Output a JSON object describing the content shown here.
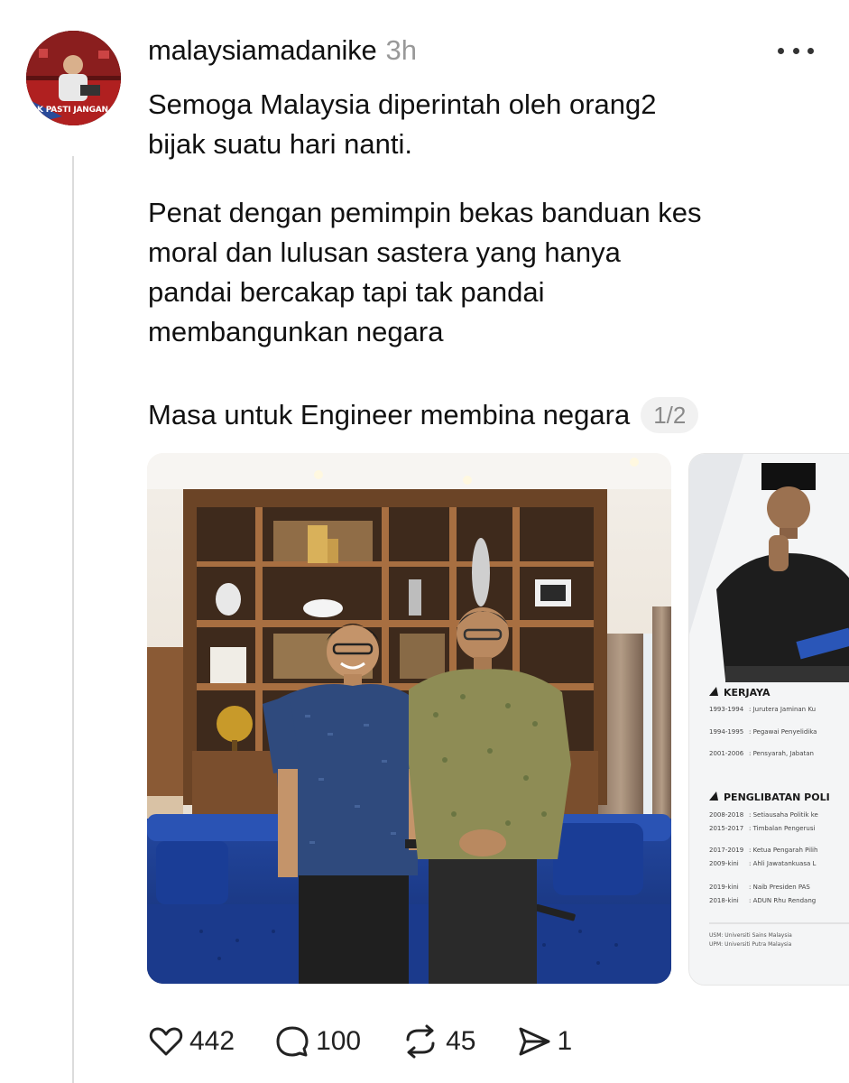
{
  "post": {
    "username": "malaysiamadanike",
    "time": "3h",
    "avatar_caption": "TAK PASTI JANGAN KO",
    "paragraphs": [
      "Semoga Malaysia diperintah oleh orang2 bijak suatu hari nanti.",
      "Penat dengan pemimpin bekas banduan kes moral dan lulusan sastera yang hanya pandai bercakap tapi tak pandai membangunkan negara",
      "Masa untuk Engineer membina negara"
    ],
    "p1_lines": [
      "Semoga Malaysia diperintah oleh orang2",
      "bijak suatu hari nanti."
    ],
    "p2_lines": [
      "Penat dengan pemimpin bekas banduan kes",
      "moral dan lulusan sastera yang hanya",
      "pandai bercakap tapi tak pandai",
      "membangunkan negara"
    ],
    "image_counter": "1/2"
  },
  "second_image": {
    "section_career": "KERJAYA",
    "career_years": [
      "1993-1994",
      "1994-1995",
      "2001-2006"
    ],
    "section_politics": "PENGLIBATAN POLI",
    "politics_years": [
      "2008-2018",
      "2015-2017",
      "2017-2019",
      "2009-kini",
      "2019-kini",
      "2018-kini"
    ],
    "politics_items": [
      ": Setiausaha Politik ke",
      ": Timbalan Pengerusi",
      ": Ketua Pengarah Pilih",
      ": Ahli Jawatankuasa L",
      ": Naib Presiden PAS",
      ": ADUN Rhu Rendang"
    ],
    "career_items": [
      ": Jurutera Jaminan Ku",
      ": Pegawai Penyelidika",
      ": Pensyarah, Jabatan"
    ],
    "footnotes": [
      "USM: Universiti Sains Malaysia",
      "UPM: Universiti Putra Malaysia"
    ]
  },
  "actions": {
    "likes": "442",
    "comments": "100",
    "reposts": "45",
    "shares": "1"
  },
  "colors": {
    "text": "#111111",
    "muted": "#999999",
    "thread_line": "#dcdcdc",
    "sofa": "#1f3a8a"
  }
}
